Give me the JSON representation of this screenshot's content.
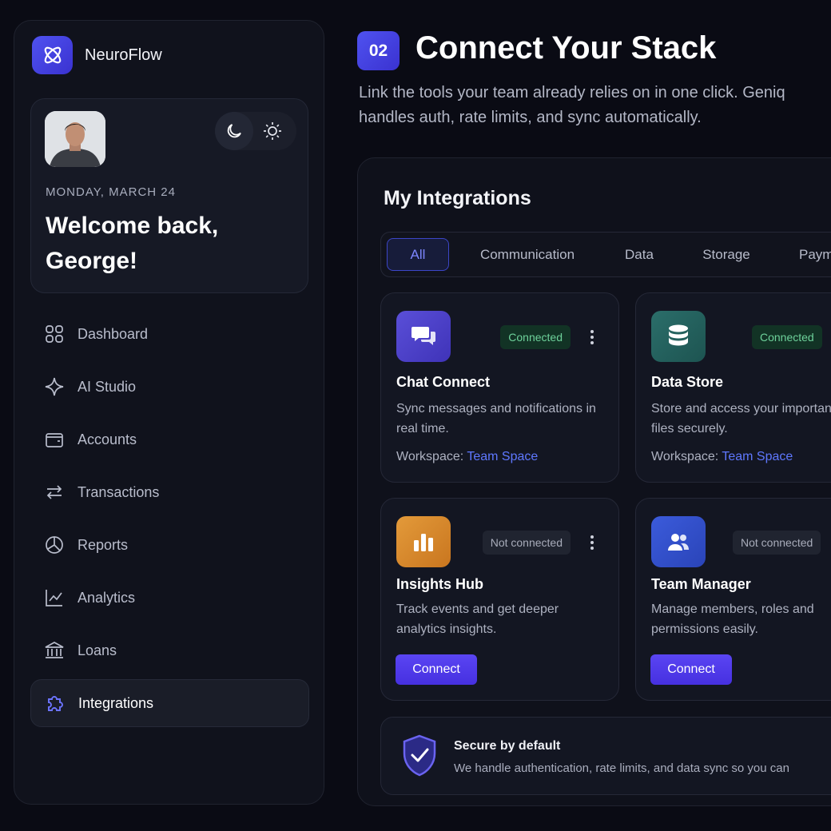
{
  "brand": {
    "name": "NeuroFlow"
  },
  "welcome": {
    "date": "MONDAY, MARCH 24",
    "greeting": "Welcome back, George!"
  },
  "nav": [
    {
      "label": "Dashboard",
      "icon": "grid-icon"
    },
    {
      "label": "AI Studio",
      "icon": "sparkle-icon"
    },
    {
      "label": "Accounts",
      "icon": "wallet-icon"
    },
    {
      "label": "Transactions",
      "icon": "transfer-arrows-icon"
    },
    {
      "label": "Reports",
      "icon": "pie-chart-icon"
    },
    {
      "label": "Analytics",
      "icon": "line-chart-icon"
    },
    {
      "label": "Loans",
      "icon": "bank-icon"
    },
    {
      "label": "Integrations",
      "icon": "puzzle-icon",
      "active": true
    }
  ],
  "header": {
    "step": "02",
    "title": "Connect Your Stack",
    "subtitle": "Link the tools your team already relies on in one click. Geniq handles auth, rate limits, and sync automatically."
  },
  "integrations": {
    "title": "My Integrations",
    "tabs": [
      "All",
      "Communication",
      "Data",
      "Storage",
      "Paym"
    ],
    "active_tab": "All",
    "workspace_label": "Workspace:",
    "cards": [
      {
        "name": "Chat Connect",
        "status": "Connected",
        "description": "Sync messages and notifications in real time.",
        "workspace": "Team Space",
        "icon": "chat-bubbles-icon"
      },
      {
        "name": "Data Store",
        "status": "Connected",
        "description": "Store and access your important files securely.",
        "workspace": "Team Space",
        "icon": "database-icon"
      },
      {
        "name": "Insights Hub",
        "status": "Not connected",
        "description": "Track events and get deeper analytics insights.",
        "button": "Connect",
        "icon": "bar-chart-icon"
      },
      {
        "name": "Team Manager",
        "status": "Not connected",
        "description": "Manage members, roles and permissions easily.",
        "button": "Connect",
        "icon": "users-icon"
      }
    ],
    "secure": {
      "title": "Secure by default",
      "text": "We handle authentication, rate limits, and data sync so you can"
    }
  },
  "colors": {
    "accent": "#4f52f0",
    "connected": "#6ed29b",
    "link": "#5f78ff",
    "background": "#0a0b14"
  }
}
